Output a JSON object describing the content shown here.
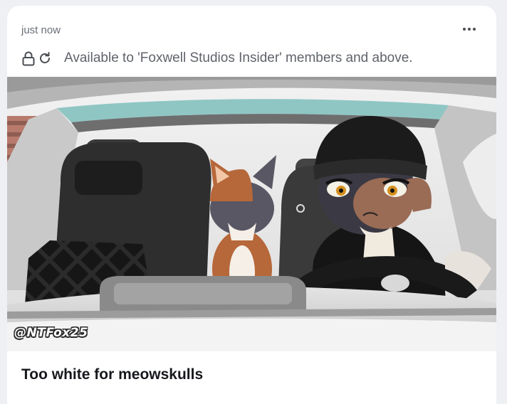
{
  "post": {
    "timestamp": "just now",
    "access_notice": "Available to 'Foxwell Studios Insider' members and above.",
    "title": "Too white for meowskulls",
    "image_watermark": "@NTFox25"
  },
  "icons": {
    "more": "more-horizontal-icon",
    "lock": "lock-icon",
    "refresh": "refresh-icon"
  },
  "colors": {
    "page_background": "#eef0f3",
    "card_background": "#ffffff",
    "muted_text": "#6b6f76",
    "title_text": "#16181c"
  }
}
